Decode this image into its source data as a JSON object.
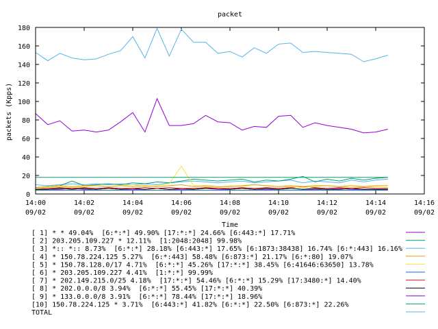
{
  "chart_data": {
    "type": "line",
    "title": "packet",
    "xlabel": "Time",
    "ylabel": "packets (Kpps)",
    "ylim": [
      0,
      180
    ],
    "yticks": [
      0,
      20,
      40,
      60,
      80,
      100,
      120,
      140,
      160,
      180
    ],
    "grid": false,
    "legend_position": "bottom",
    "x": [
      0,
      0.5,
      1,
      1.5,
      2,
      2.5,
      3,
      3.5,
      4,
      4.5,
      5,
      5.5,
      6,
      6.5,
      7,
      7.5,
      8,
      8.5,
      9,
      9.5,
      10,
      10.5,
      11,
      11.5,
      12,
      12.5,
      13,
      13.5,
      14,
      14.5
    ],
    "xticks": [
      {
        "time": "14:00",
        "date": "09/02"
      },
      {
        "time": "14:02",
        "date": "09/02"
      },
      {
        "time": "14:04",
        "date": "09/02"
      },
      {
        "time": "14:06",
        "date": "09/02"
      },
      {
        "time": "14:08",
        "date": "09/02"
      },
      {
        "time": "14:10",
        "date": "09/02"
      },
      {
        "time": "14:12",
        "date": "09/02"
      },
      {
        "time": "14:14",
        "date": "09/02"
      },
      {
        "time": "14:16",
        "date": "09/02"
      }
    ],
    "series": [
      {
        "name": "[ 1] * * 49.04%  [6:*:*] 49.90% [17:*:*] 24.66% [6:443:*] 17.71%",
        "color": "#9400d3",
        "values": [
          87,
          75,
          79,
          68,
          69,
          67,
          69,
          78,
          88,
          67,
          103,
          74,
          74,
          76,
          85,
          78,
          77,
          69,
          73,
          72,
          84,
          85,
          72,
          77,
          74,
          72,
          70,
          66,
          67,
          70
        ]
      },
      {
        "name": "[ 2] 203.205.109.227 * 12.11%  [1:2048:2048] 99.98%",
        "color": "#009e73",
        "values": [
          18,
          18,
          18,
          18,
          18,
          18,
          18,
          18,
          18,
          18,
          18,
          18,
          18,
          18,
          18,
          18,
          18,
          18,
          18,
          18,
          18,
          18,
          18,
          18,
          18,
          18,
          18,
          18,
          18,
          18
        ]
      },
      {
        "name": "[ 3] *:: *:: 8.73%  [6:*:*] 28.18% [6:443:*] 17.65% [6:1873:38438] 16.74% [6:*:443] 16.16%",
        "color": "#56b4e9",
        "values": [
          153,
          144,
          152,
          147,
          145,
          146,
          151,
          155,
          170,
          147,
          179,
          149,
          178,
          164,
          164,
          152,
          154,
          148,
          158,
          152,
          162,
          163,
          153,
          154,
          153,
          152,
          151,
          143,
          146,
          150
        ]
      },
      {
        "name": "[ 4] * 150.78.224.125 5.27%  [6:*:443] 58.48% [6:873:*] 21.17% [6:*:80] 19.07%",
        "color": "#e69f00",
        "values": [
          7,
          8,
          9,
          8,
          9,
          9,
          8,
          9,
          8,
          9,
          8,
          9,
          10,
          8,
          9,
          8,
          8,
          9,
          10,
          9,
          8,
          9,
          8,
          9,
          9,
          8,
          9,
          8,
          9,
          9
        ]
      },
      {
        "name": "[ 5] * 150.78.128.0/17 4.71%  [6:*:*] 45.26% [17:*:*] 38.45% [6:41646:63650] 13.78%",
        "color": "#f0e442",
        "values": [
          6,
          7,
          8,
          7,
          8,
          9,
          8,
          9,
          10,
          8,
          9,
          11,
          30,
          9,
          8,
          7,
          9,
          8,
          10,
          9,
          8,
          8,
          7,
          8,
          9,
          8,
          7,
          8,
          8,
          7
        ]
      },
      {
        "name": "[ 6] * 203.205.109.227 4.41%  [1:*:*] 99.99%",
        "color": "#0072b2",
        "values": [
          4,
          4,
          4,
          4,
          4,
          4,
          4,
          4,
          4,
          4,
          4,
          4,
          4,
          4,
          4,
          4,
          4,
          4,
          4,
          4,
          4,
          4,
          4,
          4,
          4,
          4,
          4,
          4,
          4,
          4
        ]
      },
      {
        "name": "[ 7] * 202.149.215.0/25 4.18%  [17:*:*] 54.46% [6:*:*] 15.29% [17:3480:*] 14.40%",
        "color": "#e51e10",
        "values": [
          6,
          6,
          7,
          6,
          7,
          6,
          7,
          6,
          6,
          7,
          6,
          7,
          6,
          6,
          7,
          6,
          6,
          7,
          6,
          7,
          6,
          7,
          8,
          7,
          6,
          7,
          6,
          7,
          6,
          6
        ]
      },
      {
        "name": "[ 8] * 202.0.0.0/8 3.94%  [6:*:*] 55.45% [17:*:*] 40.39%",
        "color": "#000000",
        "values": [
          5,
          5,
          6,
          5,
          6,
          5,
          6,
          5,
          6,
          5,
          6,
          5,
          6,
          5,
          6,
          6,
          5,
          6,
          5,
          6,
          5,
          6,
          5,
          6,
          5,
          5,
          6,
          5,
          5,
          5
        ]
      },
      {
        "name": "[ 9] * 133.0.0.0/8 3.91%  [6:*:*] 78.44% [17:*:*] 18.96%",
        "color": "#9400d3",
        "values": [
          5,
          5,
          5,
          6,
          5,
          5,
          6,
          5,
          5,
          5,
          6,
          5,
          5,
          5,
          6,
          5,
          5,
          6,
          5,
          5,
          5,
          6,
          5,
          5,
          5,
          6,
          5,
          5,
          5,
          5
        ]
      },
      {
        "name": "[10] 150.78.224.125 * 3.71%  [6:443:*] 41.82% [6:*:*] 22.50% [6:873:*] 22.26%",
        "color": "#009e73",
        "values": [
          7,
          8,
          9,
          14,
          9,
          10,
          11,
          10,
          12,
          11,
          13,
          12,
          14,
          16,
          15,
          14,
          15,
          16,
          13,
          15,
          14,
          16,
          19,
          13,
          16,
          14,
          17,
          15,
          17,
          18
        ]
      },
      {
        "name": "TOTAL",
        "color": "#56b4e9",
        "values": [
          10,
          9,
          10,
          11,
          10,
          11,
          10,
          11,
          10,
          11,
          10,
          12,
          13,
          14,
          13,
          12,
          13,
          14,
          12,
          13,
          14,
          15,
          12,
          14,
          13,
          12,
          15,
          13,
          15,
          16
        ]
      }
    ]
  }
}
